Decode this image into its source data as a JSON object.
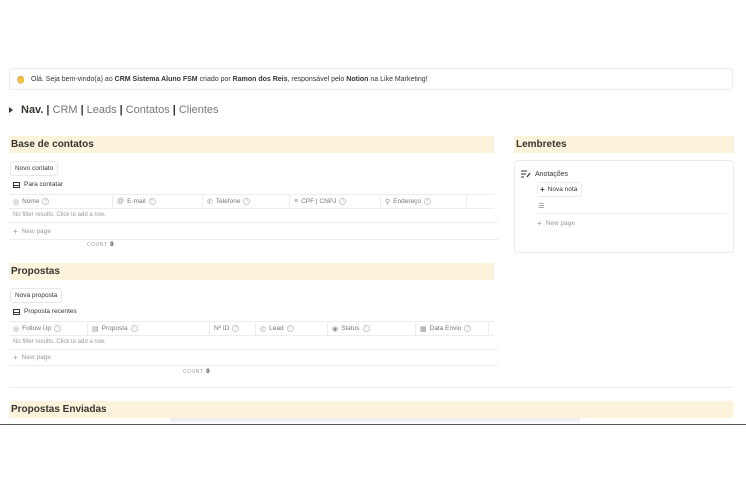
{
  "callout": {
    "emoji_icon": "waving-hand-icon",
    "p1": "Olá. Seja bem-vindo(a) ao ",
    "b1": "CRM Sistema Aluno FSM",
    "p2": " criado por ",
    "b2": "Ramon dos Reis",
    "p3": ", responsável pelo ",
    "b3": "Notion",
    "p4": " na Like Marketing!"
  },
  "nav": {
    "label": "Nav.",
    "sep": "|",
    "links": [
      "CRM",
      "Leads",
      "Contatos",
      "Clientes"
    ]
  },
  "contatos": {
    "title": "Base de contatos",
    "new_button": "Novo contato",
    "view_name": "Para contatar",
    "columns": [
      "Nome",
      "E-mail",
      "Telefone",
      "CPF | CNPJ",
      "Endereço"
    ],
    "empty_text": "No filter results. Click to add a row.",
    "new_page": "New page",
    "count_label": "COUNT",
    "count_value": "0"
  },
  "propostas": {
    "title": "Propostas",
    "new_button": "Nova proposta",
    "view_name": "Proposta recentes",
    "columns": [
      "Follow Up",
      "Proposta",
      "Nº ID",
      "Lead",
      "Status",
      "Data Envio"
    ],
    "empty_text": "No filter results. Click to add a row.",
    "new_page": "New page",
    "count_label": "COUNT",
    "count_value": "0"
  },
  "enviadas": {
    "title": "Propostas Enviadas"
  },
  "lembretes": {
    "title": "Lembretes",
    "list_title": "Anotações",
    "new_button": "Nova nota",
    "new_page": "New page"
  },
  "colors": {
    "section_bg": "#fbf3db",
    "text": "#37352f",
    "muted": "#9b9a97"
  }
}
